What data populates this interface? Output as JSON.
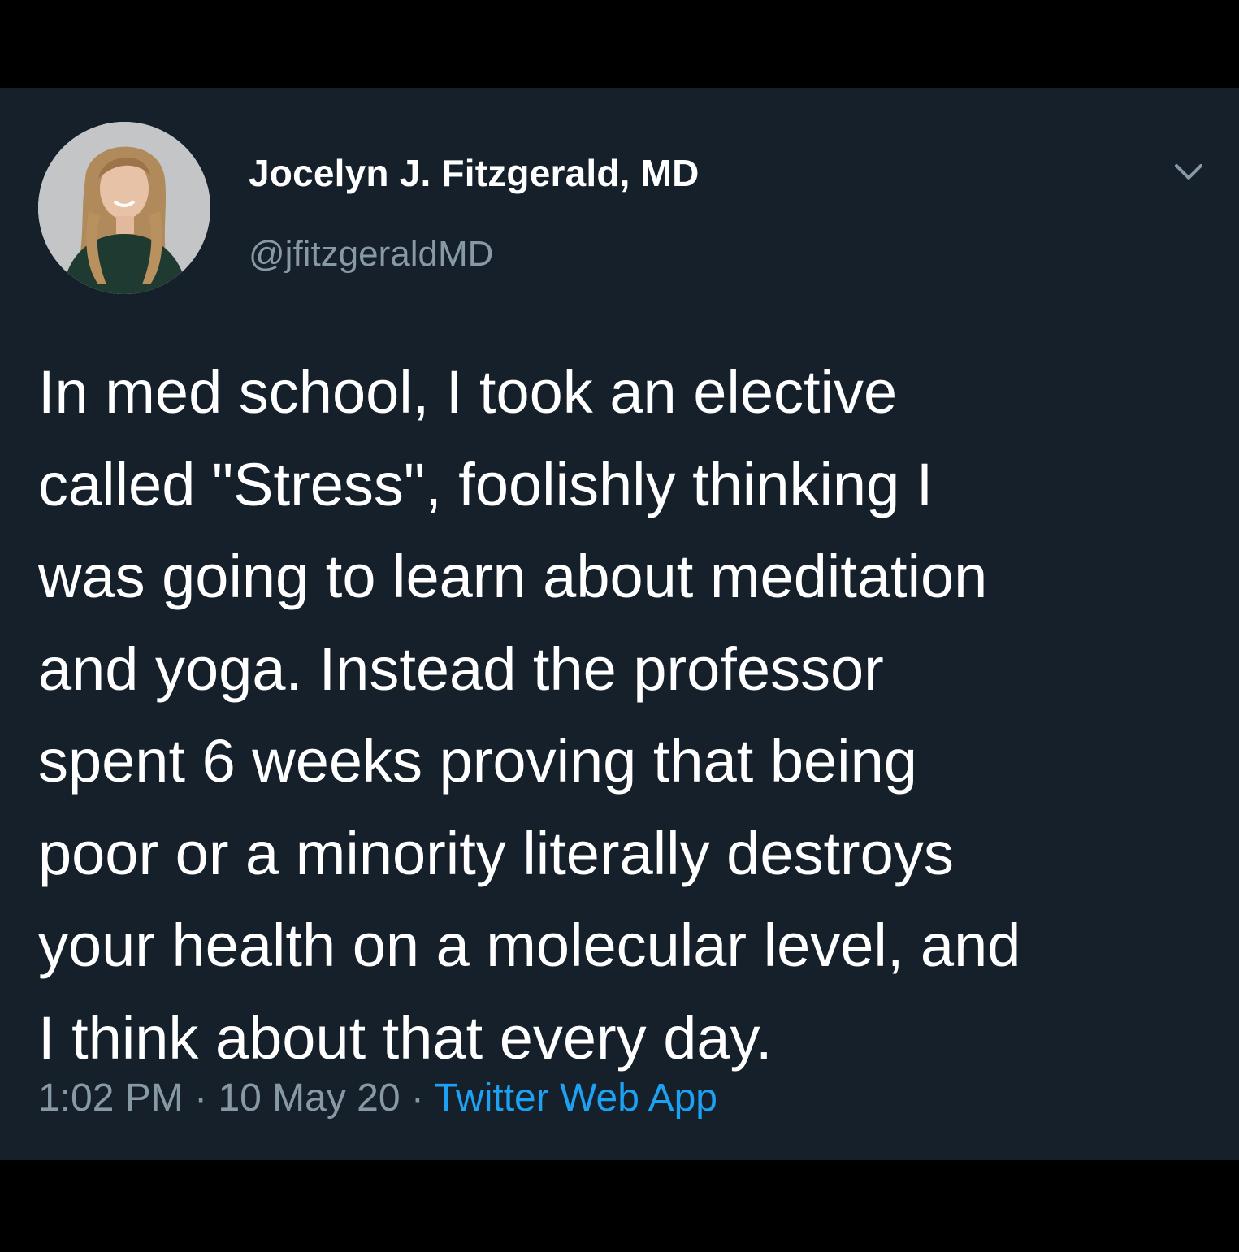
{
  "tweet": {
    "author": {
      "display_name": "Jocelyn J. Fitzgerald, MD",
      "handle": "@jfitzgeraldMD",
      "avatar_icon": "profile-photo"
    },
    "menu_icon": "chevron-down-icon",
    "text_lines": [
      "In med school, I took an elective",
      "called \"Stress\", foolishly thinking I",
      "was going to learn about meditation",
      "and yoga. Instead the professor",
      "spent 6 weeks proving that being",
      "poor or a minority literally destroys",
      "your health on a molecular level, and",
      "I think about that every day."
    ],
    "time": "1:02 PM",
    "separator": "·",
    "date": "10 May 20",
    "source": "Twitter Web App"
  },
  "colors": {
    "background": "#15202b",
    "text": "#ffffff",
    "secondary_text": "#8899a6",
    "link": "#1da1f2",
    "frame": "#000000"
  }
}
